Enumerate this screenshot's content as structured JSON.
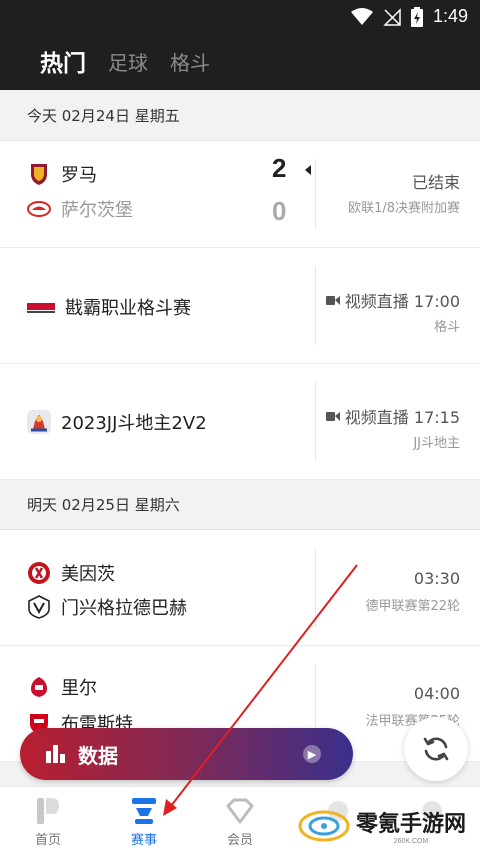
{
  "status_bar": {
    "time": "1:49"
  },
  "header": {
    "tabs": [
      {
        "label": "热门"
      },
      {
        "label": "足球"
      },
      {
        "label": "格斗"
      }
    ]
  },
  "sections": [
    {
      "date": "今天 02月24日 星期五"
    },
    {
      "date": "明天 02月25日 星期六"
    }
  ],
  "today": {
    "match1": {
      "home": "罗马",
      "away": "萨尔茨堡",
      "home_score": "2",
      "away_score": "0",
      "status": "已结束",
      "league": "欧联1/8决赛附加赛"
    },
    "event1": {
      "title": "戡霸职业格斗赛",
      "live_text": "视频直播 17:00",
      "category": "格斗"
    },
    "event2": {
      "title": "2023JJ斗地主2V2",
      "live_text": "视频直播 17:15",
      "category": "JJ斗地主"
    }
  },
  "tomorrow": {
    "match1": {
      "home": "美因茨",
      "away": "门兴格拉德巴赫",
      "time": "03:30",
      "league": "德甲联赛第22轮"
    },
    "match2": {
      "home": "里尔",
      "away": "布雷斯特",
      "time": "04:00",
      "league": "法甲联赛第25轮"
    }
  },
  "data_bar": {
    "label": "数据"
  },
  "bottom_nav": [
    {
      "label": "首页"
    },
    {
      "label": "赛事"
    },
    {
      "label": "会员"
    }
  ],
  "watermark": {
    "text": "零氪手游网",
    "sub": "260K.COM"
  },
  "colors": {
    "header_bg": "#1f1f1f",
    "accent": "#1a73e8",
    "annotation": "#e02020"
  }
}
